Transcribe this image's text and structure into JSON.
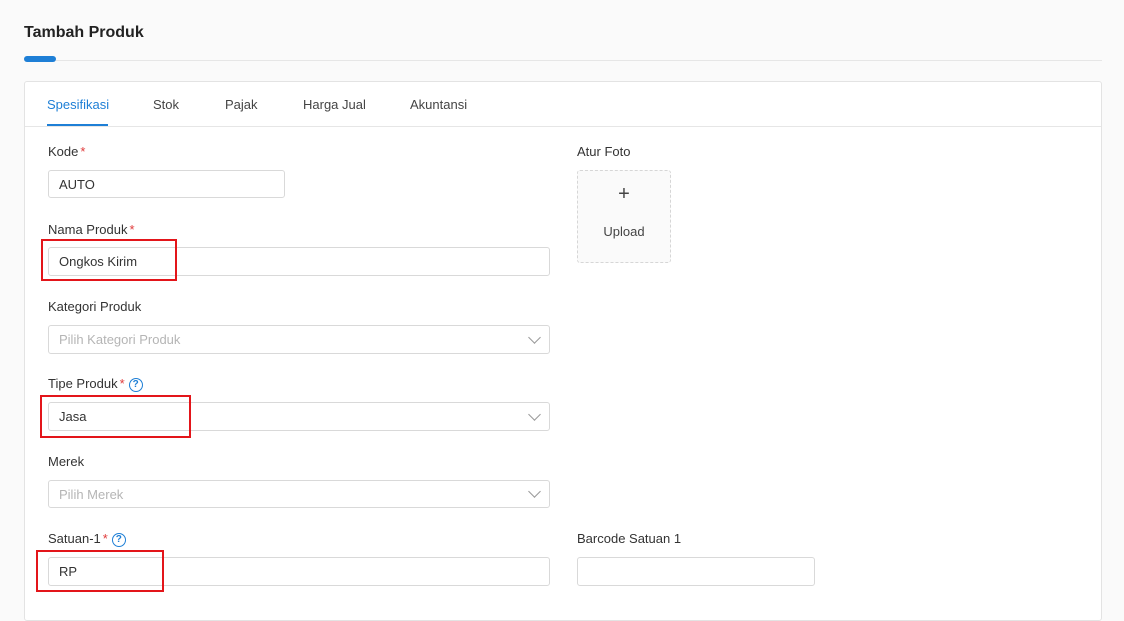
{
  "page": {
    "title": "Tambah Produk"
  },
  "tabs": [
    {
      "label": "Spesifikasi",
      "active": true
    },
    {
      "label": "Stok"
    },
    {
      "label": "Pajak"
    },
    {
      "label": "Harga Jual"
    },
    {
      "label": "Akuntansi"
    }
  ],
  "form": {
    "kode": {
      "label": "Kode",
      "required": "*",
      "value": "AUTO"
    },
    "nama_produk": {
      "label": "Nama Produk",
      "required": "*",
      "value": "Ongkos Kirim"
    },
    "kategori_produk": {
      "label": "Kategori Produk",
      "placeholder": "Pilih Kategori Produk"
    },
    "tipe_produk": {
      "label": "Tipe Produk",
      "required": "*",
      "help_icon": "?",
      "value": "Jasa"
    },
    "merek": {
      "label": "Merek",
      "placeholder": "Pilih Merek"
    },
    "satuan_1": {
      "label": "Satuan-1",
      "required": "*",
      "help_icon": "?",
      "value": "RP"
    },
    "barcode_satuan_1": {
      "label": "Barcode Satuan 1",
      "value": ""
    }
  },
  "photo": {
    "label": "Atur Foto",
    "plus": "+",
    "upload_label": "Upload"
  },
  "colors": {
    "accent": "#1e7fd6",
    "required": "#e03a3a",
    "highlight": "#e3151a"
  }
}
